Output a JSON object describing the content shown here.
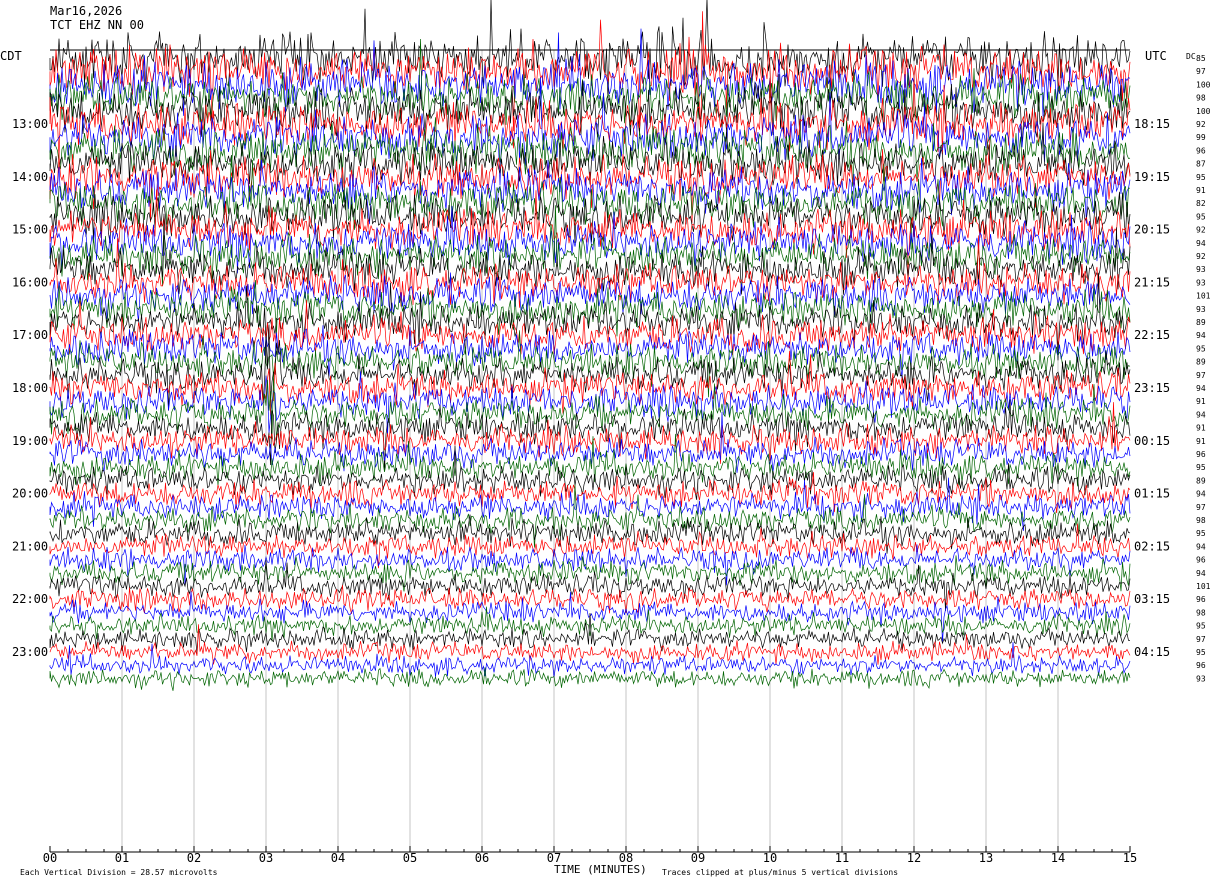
{
  "header": {
    "date": "Mar16,2026",
    "channel": "TCT EHZ NN 00"
  },
  "chart_data": {
    "type": "line",
    "title": "",
    "left_axis_label": "CDT",
    "right_axis_label": "UTC",
    "dc_label": "DC",
    "xlabel": "TIME (MINUTES)",
    "xlim": [
      0,
      15
    ],
    "x_ticks": [
      "00",
      "01",
      "02",
      "03",
      "04",
      "05",
      "06",
      "07",
      "08",
      "09",
      "10",
      "11",
      "12",
      "13",
      "14",
      "15"
    ],
    "left_hour_labels": [
      "13:00",
      "14:00",
      "15:00",
      "16:00",
      "17:00",
      "18:00",
      "19:00",
      "20:00",
      "21:00",
      "22:00",
      "23:00"
    ],
    "right_hour_labels": [
      "18:15",
      "19:15",
      "20:15",
      "21:15",
      "22:15",
      "23:15",
      "00:15",
      "01:15",
      "02:15",
      "03:15",
      "04:15"
    ],
    "dc_values": [
      "85",
      "97",
      "100",
      "98",
      "100",
      "92",
      "99",
      "96",
      "87",
      "95",
      "91",
      "82",
      "95",
      "92",
      "94",
      "92",
      "93",
      "93",
      "101",
      "93",
      "89",
      "94",
      "95",
      "89",
      "97",
      "94",
      "91",
      "94",
      "91",
      "91",
      "96",
      "95",
      "89",
      "94",
      "97",
      "98",
      "95",
      "94",
      "96",
      "94",
      "101",
      "96",
      "98",
      "95",
      "97",
      "95",
      "96",
      "93"
    ],
    "trace_colors": [
      "#000000",
      "#ff0000",
      "#0000ff",
      "#006400"
    ],
    "trace_count": 48,
    "trace_interval_minutes": 15,
    "scale_note": "Each Vertical Division =   28.57 microvolts",
    "clip_note": "Traces clipped at plus/minus 5 vertical divisions"
  }
}
